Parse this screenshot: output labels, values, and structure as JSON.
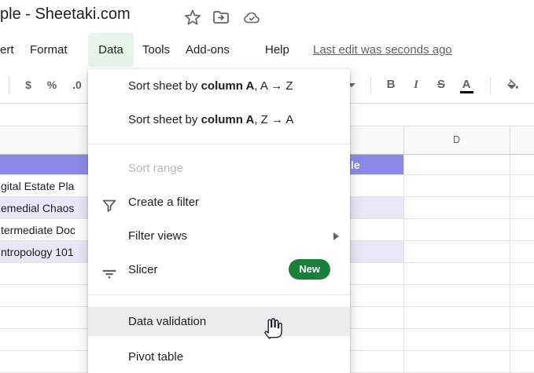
{
  "colors": {
    "header_purple": "#8a8ae8",
    "band_purple": "#e8e7f9",
    "badge_green": "#188038",
    "menu_active_green": "#e6f4ea",
    "hover_gray": "#ececec"
  },
  "titlebar": {
    "title_fragment": "ple - Sheetaki.com"
  },
  "menubar": {
    "insert_fragment": "ert",
    "format": "Format",
    "data": "Data",
    "tools": "Tools",
    "addons": "Add-ons",
    "help": "Help",
    "last_edit": "Last edit was seconds ago"
  },
  "toolbar": {
    "currency": "$",
    "percent": "%",
    "decrease_decimal": ".0",
    "bold": "B",
    "italic": "I",
    "strikethrough": "S",
    "text_color": "A"
  },
  "data_menu": {
    "sort_az_pre": "Sort sheet by ",
    "sort_az_bold": "column A",
    "sort_az_post": ", A → Z",
    "sort_za_pre": "Sort sheet by ",
    "sort_za_bold": "column A",
    "sort_za_post": ", Z → A",
    "sort_range": "Sort range",
    "create_filter": "Create a filter",
    "filter_views": "Filter views",
    "slicer": "Slicer",
    "slicer_badge": "New",
    "data_validation": "Data validation",
    "pivot_table": "Pivot table"
  },
  "sheet": {
    "visible_column_header": "D",
    "header_row_fragment": "le",
    "row_fragments": [
      "gital Estate Pla",
      "emedial Chaos",
      "termediate Doc",
      "ntropology 101"
    ]
  }
}
